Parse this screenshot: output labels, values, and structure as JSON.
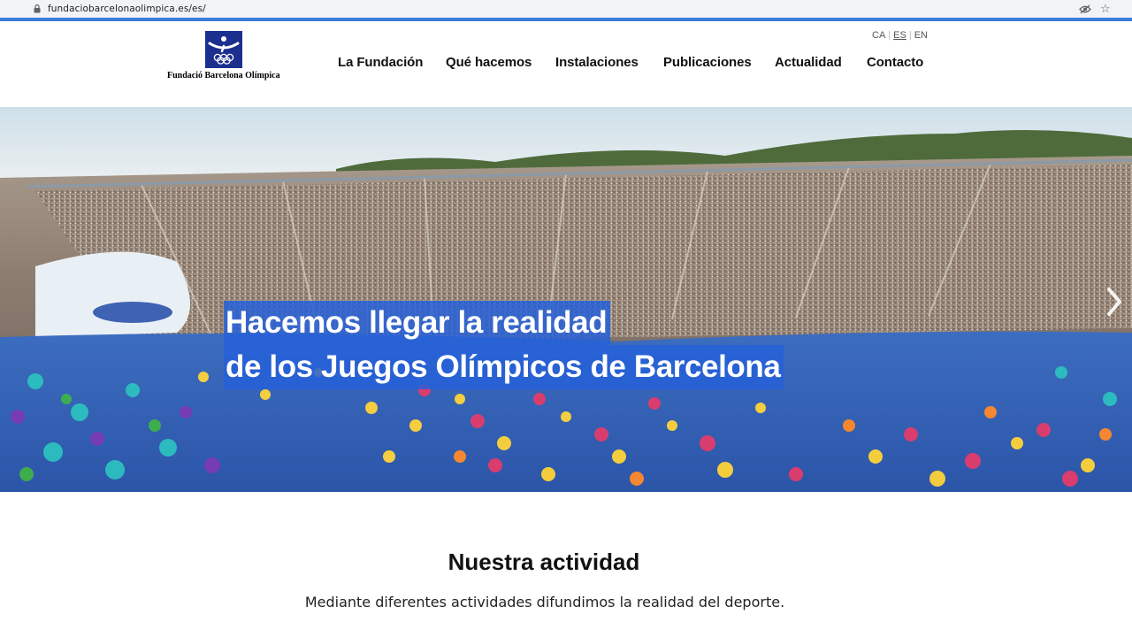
{
  "browser": {
    "url": "fundaciobarcelonaolimpica.es/es/"
  },
  "header": {
    "logo_text": "Fundació Barcelona Olímpica",
    "languages": [
      {
        "code": "CA",
        "active": false
      },
      {
        "code": "ES",
        "active": true
      },
      {
        "code": "EN",
        "active": false
      }
    ],
    "nav": [
      "La Fundación",
      "Qué hacemos",
      "Instalaciones",
      "Publicaciones",
      "Actualidad",
      "Contacto"
    ]
  },
  "hero": {
    "caption_line1": "Hacemos llegar la realidad",
    "caption_line2": "de los Juegos Olímpicos de Barcelona",
    "next_icon": "chevron-right-icon"
  },
  "activity": {
    "title": "Nuestra actividad",
    "description": "Mediante diferentes actividades difundimos la realidad del deporte."
  },
  "colors": {
    "accent": "#3b7ddd",
    "logo_blue": "#1c2f8f",
    "caption_bg": "#2660d8"
  }
}
